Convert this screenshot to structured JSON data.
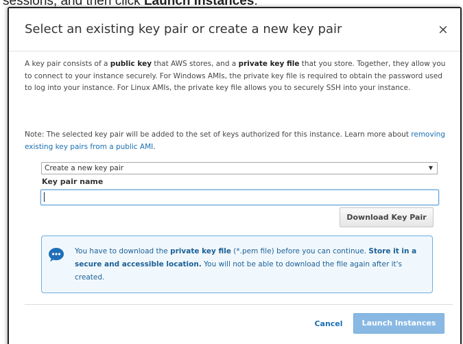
{
  "background_text": {
    "part1": "sessions, and then click ",
    "part2": "Launch Instances",
    "part3": "."
  },
  "modal": {
    "title": "Select an existing key pair or create a new key pair",
    "close_glyph": "×"
  },
  "description": {
    "t1": "A key pair consists of a ",
    "b1": "public key",
    "t2": " that AWS stores, and a ",
    "b2": "private key file",
    "t3": " that you store. Together, they allow you to connect to your instance securely. For Windows AMIs, the private key file is required to obtain the password used to log into your instance. For Linux AMIs, the private key file allows you to securely SSH into your instance."
  },
  "note": {
    "t1": "Note: The selected key pair will be added to the set of keys authorized for this instance. Learn more about ",
    "link": "removing existing key pairs from a public AMI",
    "t2": "."
  },
  "key_pair_select": {
    "selected": "Create a new key pair",
    "arrow": "▼"
  },
  "key_pair_name": {
    "label": "Key pair name",
    "value": ""
  },
  "download_button": "Download Key Pair",
  "info": {
    "t1": "You have to download the ",
    "b1": "private key file",
    "t2": " (*.pem file) before you can continue. ",
    "b2": "Store it in a secure and accessible location.",
    "t3": " You will not be able to download the file again after it's created."
  },
  "footer": {
    "cancel": "Cancel",
    "launch": "Launch Instances"
  },
  "colors": {
    "link": "#1a6fb3",
    "info_border": "#6aaee0",
    "info_bg": "#f1f8fd",
    "launch_disabled": "#89b9e3"
  },
  "icons": {
    "info": "chat-bubble-ellipsis-icon",
    "close": "close-icon",
    "dropdown": "dropdown-arrow-icon"
  }
}
